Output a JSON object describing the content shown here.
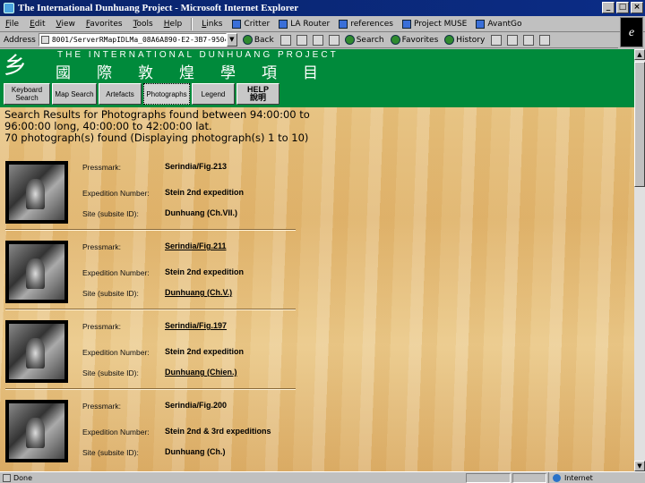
{
  "window": {
    "title": "The International Dunhuang Project - Microsoft Internet Explorer",
    "min": "_",
    "max": "□",
    "close": "×"
  },
  "menu": {
    "items": [
      "File",
      "Edit",
      "View",
      "Favorites",
      "Tools",
      "Help"
    ],
    "links_label": "Links",
    "links": [
      "Critter",
      "LA Router",
      "references",
      "Project MUSE",
      "AvantGo"
    ]
  },
  "address": {
    "label": "Address",
    "value": "8001/ServerRMapIDLMa_08A6A890-E2-3B7-9504",
    "back": "Back",
    "search": "Search",
    "favorites": "Favorites",
    "history": "History"
  },
  "banner": {
    "logo": "乡",
    "english": "THE  INTERNATIONAL  DUNHUANG  PROJECT",
    "chinese": "國際敦煌學項目"
  },
  "nav": {
    "keyboard": "Keyboard Search",
    "map": "Map Search",
    "artefacts": "Artefacts",
    "photographs": "Photographs",
    "legend": "Legend",
    "help": "HELP",
    "help_cn": "說明"
  },
  "results": {
    "line1": "Search Results for Photographs found between 94:00:00 to",
    "line2": "96:00:00 long, 40:00:00 to 42:00:00 lat.",
    "line3": "70 photograph(s) found (Displaying photograph(s) 1 to 10)"
  },
  "labels": {
    "pressmark": "Pressmark:",
    "expedition": "Expedition Number:",
    "site": "Site (subsite ID):"
  },
  "entries": [
    {
      "pressmark": "Serindia/Fig.213",
      "expedition": "Stein 2nd expedition",
      "site": "Dunhuang (Ch.VII.)"
    },
    {
      "pressmark": "Serindia/Fig.211",
      "expedition": "Stein 2nd expedition",
      "site": "Dunhuang (Ch.V.)"
    },
    {
      "pressmark": "Serindia/Fig.197",
      "expedition": "Stein 2nd expedition",
      "site": "Dunhuang (Chien.)"
    },
    {
      "pressmark": "Serindia/Fig.200",
      "expedition": "Stein 2nd & 3rd expeditions",
      "site": "Dunhuang (Ch.)"
    }
  ],
  "status": {
    "text": "Done",
    "zone": "Internet"
  }
}
